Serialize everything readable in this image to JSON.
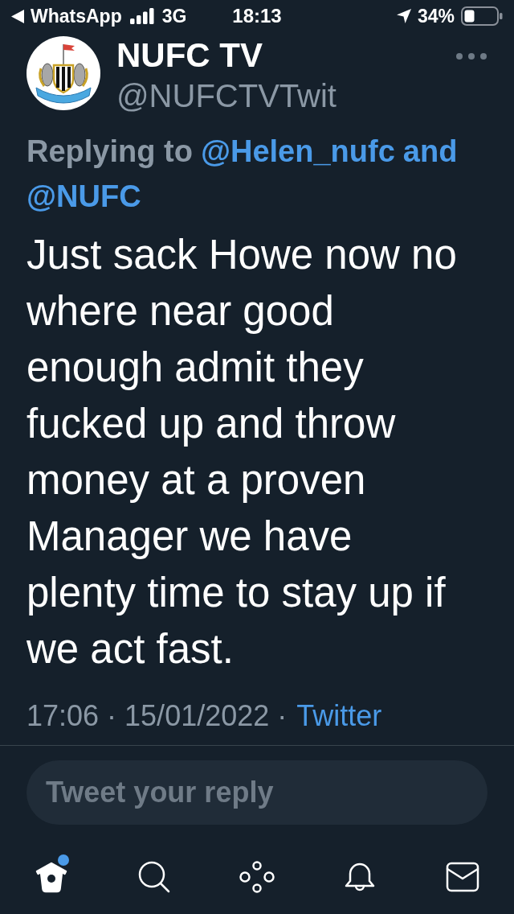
{
  "status_bar": {
    "back_label": "WhatsApp",
    "network": "3G",
    "time": "18:13",
    "battery": "34%"
  },
  "tweet": {
    "author": {
      "name": "NUFC TV",
      "handle": "@NUFCTVTwit"
    },
    "reply_context": {
      "label": "Replying to",
      "mentions": [
        "@Helen_nufc",
        "@NUFC"
      ],
      "conjunction": "and"
    },
    "text": "Just sack Howe now no where near good enough admit they fucked up and throw money at a proven Manager we have plenty time to stay up if we act fast.",
    "timestamp": "17:06 · 15/01/2022 ·",
    "source": "Twitter"
  },
  "reply_field": {
    "placeholder": "Tweet your reply"
  },
  "tab_bar": [
    {
      "kind": "home",
      "selected": true,
      "badge": true
    },
    {
      "kind": "search",
      "selected": false,
      "badge": false
    },
    {
      "kind": "spaces",
      "selected": false,
      "badge": false
    },
    {
      "kind": "notifications",
      "selected": false,
      "badge": false
    },
    {
      "kind": "messages",
      "selected": false,
      "badge": false
    }
  ]
}
